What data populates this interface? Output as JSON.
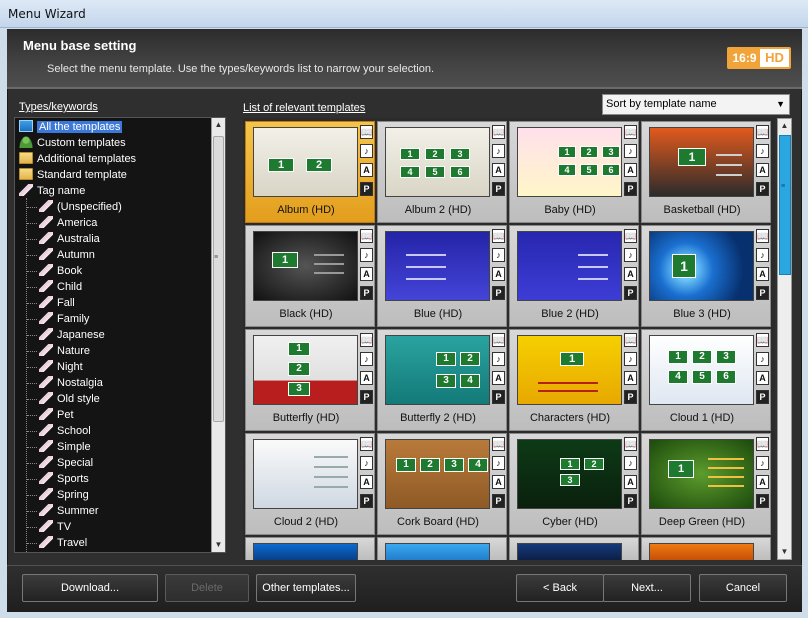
{
  "window": {
    "title": "Menu Wizard"
  },
  "header": {
    "title": "Menu base setting",
    "subtitle": "Select the menu template. Use the types/keywords list to narrow your selection.",
    "badge_ratio": "16:9",
    "badge_hd": "HD"
  },
  "left": {
    "label": "Types/keywords",
    "items": [
      {
        "label": "All the templates",
        "icon": "list-icon"
      },
      {
        "label": "Custom templates",
        "icon": "user-icon"
      },
      {
        "label": "Additional templates",
        "icon": "folder-icon"
      },
      {
        "label": "Standard template",
        "icon": "folder-icon"
      },
      {
        "label": "Tag name",
        "icon": "tag-icon"
      }
    ],
    "tags": [
      "(Unspecified)",
      "America",
      "Australia",
      "Autumn",
      "Book",
      "Child",
      "Fall",
      "Family",
      "Japanese",
      "Nature",
      "Night",
      "Nostalgia",
      "Old style",
      "Pet",
      "School",
      "Simple",
      "Special",
      "Sports",
      "Spring",
      "Summer",
      "TV",
      "Travel"
    ]
  },
  "right": {
    "label": "List of relevant templates",
    "sort_value": "Sort by template name",
    "templates": [
      "Album (HD)",
      "Album 2 (HD)",
      "Baby (HD)",
      "Basketball (HD)",
      "Black (HD)",
      "Blue (HD)",
      "Blue 2 (HD)",
      "Blue 3 (HD)",
      "Butterfly (HD)",
      "Butterfly 2 (HD)",
      "Characters (HD)",
      "Cloud 1 (HD)",
      "Cloud 2 (HD)",
      "Cork Board (HD)",
      "Cyber (HD)",
      "Deep Green (HD)"
    ],
    "feature_icons": {
      "book": "📖",
      "music": "♪",
      "text": "A",
      "p": "P"
    },
    "thumb_numbers": {
      "album": [
        "1",
        "2"
      ],
      "grid6": [
        "1",
        "2",
        "3",
        "4",
        "5",
        "6"
      ],
      "basketball": [
        "1"
      ],
      "black": [
        "1"
      ],
      "blue3": [
        "1"
      ],
      "butterfly": [
        "1",
        "2",
        "3"
      ],
      "butterfly2": [
        "1",
        "2",
        "3",
        "4"
      ],
      "characters": [
        "1"
      ],
      "cork": [
        "1",
        "2",
        "3",
        "4"
      ],
      "cyber": [
        "1",
        "2",
        "3"
      ],
      "deepgreen": [
        "1"
      ]
    }
  },
  "buttons": {
    "download": "Download...",
    "delete": "Delete",
    "other": "Other templates...",
    "back": "< Back",
    "next": "Next...",
    "cancel": "Cancel"
  }
}
